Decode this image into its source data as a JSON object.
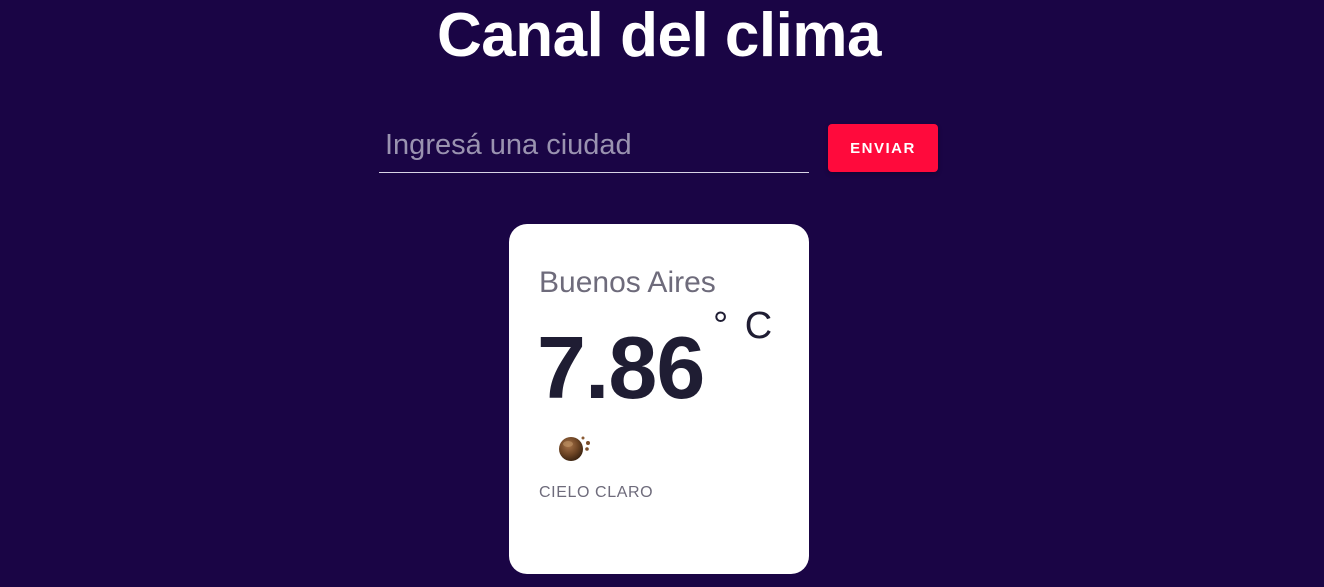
{
  "header": {
    "title": "Canal del clima"
  },
  "search": {
    "placeholder": "Ingresá una ciudad",
    "value": "",
    "submit_label": "ENVIAR"
  },
  "weather": {
    "city": "Buenos Aires",
    "temperature": "7.86",
    "unit": "° C",
    "icon": "weather-condition-icon",
    "description": "CIELO CLARO"
  },
  "colors": {
    "background": "#1a0545",
    "accent": "#ff0a3c",
    "card": "#ffffff"
  }
}
